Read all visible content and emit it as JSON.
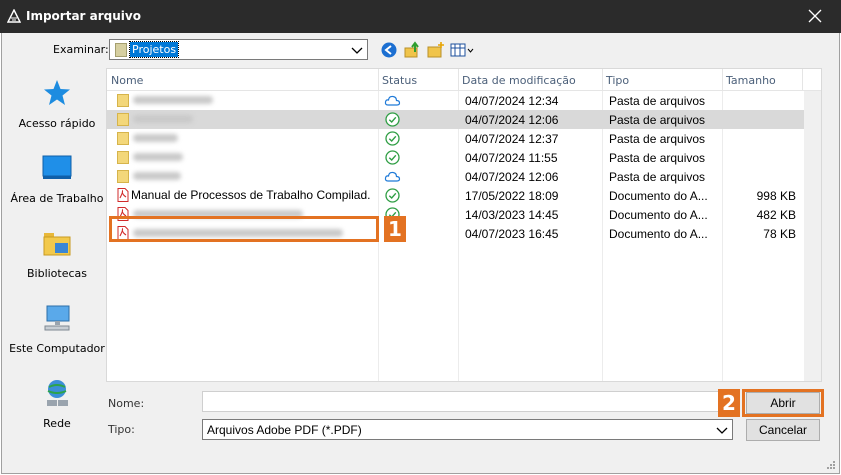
{
  "window": {
    "title": "Importar arquivo"
  },
  "toolbar": {
    "examinar_label": "Examinar:",
    "examinar_value": "Projetos"
  },
  "sidebar": {
    "places": [
      {
        "label": "Acesso rápido",
        "icon": "star-icon"
      },
      {
        "label": "Área de Trabalho",
        "icon": "desktop-icon"
      },
      {
        "label": "Bibliotecas",
        "icon": "libraries-icon"
      },
      {
        "label": "Este Computador",
        "icon": "computer-icon"
      },
      {
        "label": "Rede",
        "icon": "network-icon"
      }
    ]
  },
  "columns": {
    "name": "Nome",
    "status": "Status",
    "date": "Data de modificação",
    "type": "Tipo",
    "size": "Tamanho"
  },
  "files": [
    {
      "name": "",
      "kind": "folder",
      "status": "cloud",
      "date": "04/07/2024 12:34",
      "type": "Pasta de arquivos",
      "size": ""
    },
    {
      "name": "",
      "kind": "folder",
      "status": "synced",
      "date": "04/07/2024 12:06",
      "type": "Pasta de arquivos",
      "size": ""
    },
    {
      "name": "",
      "kind": "folder",
      "status": "synced",
      "date": "04/07/2024 12:37",
      "type": "Pasta de arquivos",
      "size": ""
    },
    {
      "name": "",
      "kind": "folder",
      "status": "synced",
      "date": "04/07/2024 11:55",
      "type": "Pasta de arquivos",
      "size": ""
    },
    {
      "name": "",
      "kind": "folder",
      "status": "cloud",
      "date": "04/07/2024 12:06",
      "type": "Pasta de arquivos",
      "size": ""
    },
    {
      "name": "Manual de Processos de Trabalho Compilad...",
      "kind": "pdf",
      "status": "synced",
      "date": "17/05/2022 18:09",
      "type": "Documento do A...",
      "size": "998 KB"
    },
    {
      "name": "",
      "kind": "pdf",
      "status": "synced",
      "date": "14/03/2023 14:45",
      "type": "Documento do A...",
      "size": "482 KB"
    },
    {
      "name": "",
      "kind": "pdf",
      "status": "synced",
      "date": "04/07/2023 16:45",
      "type": "Documento do A...",
      "size": "78 KB"
    }
  ],
  "form": {
    "nome_label": "Nome:",
    "nome_value": "",
    "tipo_label": "Tipo:",
    "tipo_value": "Arquivos Adobe PDF (*.PDF)"
  },
  "buttons": {
    "open": "Abrir",
    "cancel": "Cancelar"
  },
  "annotations": {
    "step1": "1",
    "step2": "2"
  },
  "colors": {
    "accent": "#e37222",
    "selection": "#0078d7",
    "titlebar": "#2b2b2b"
  }
}
